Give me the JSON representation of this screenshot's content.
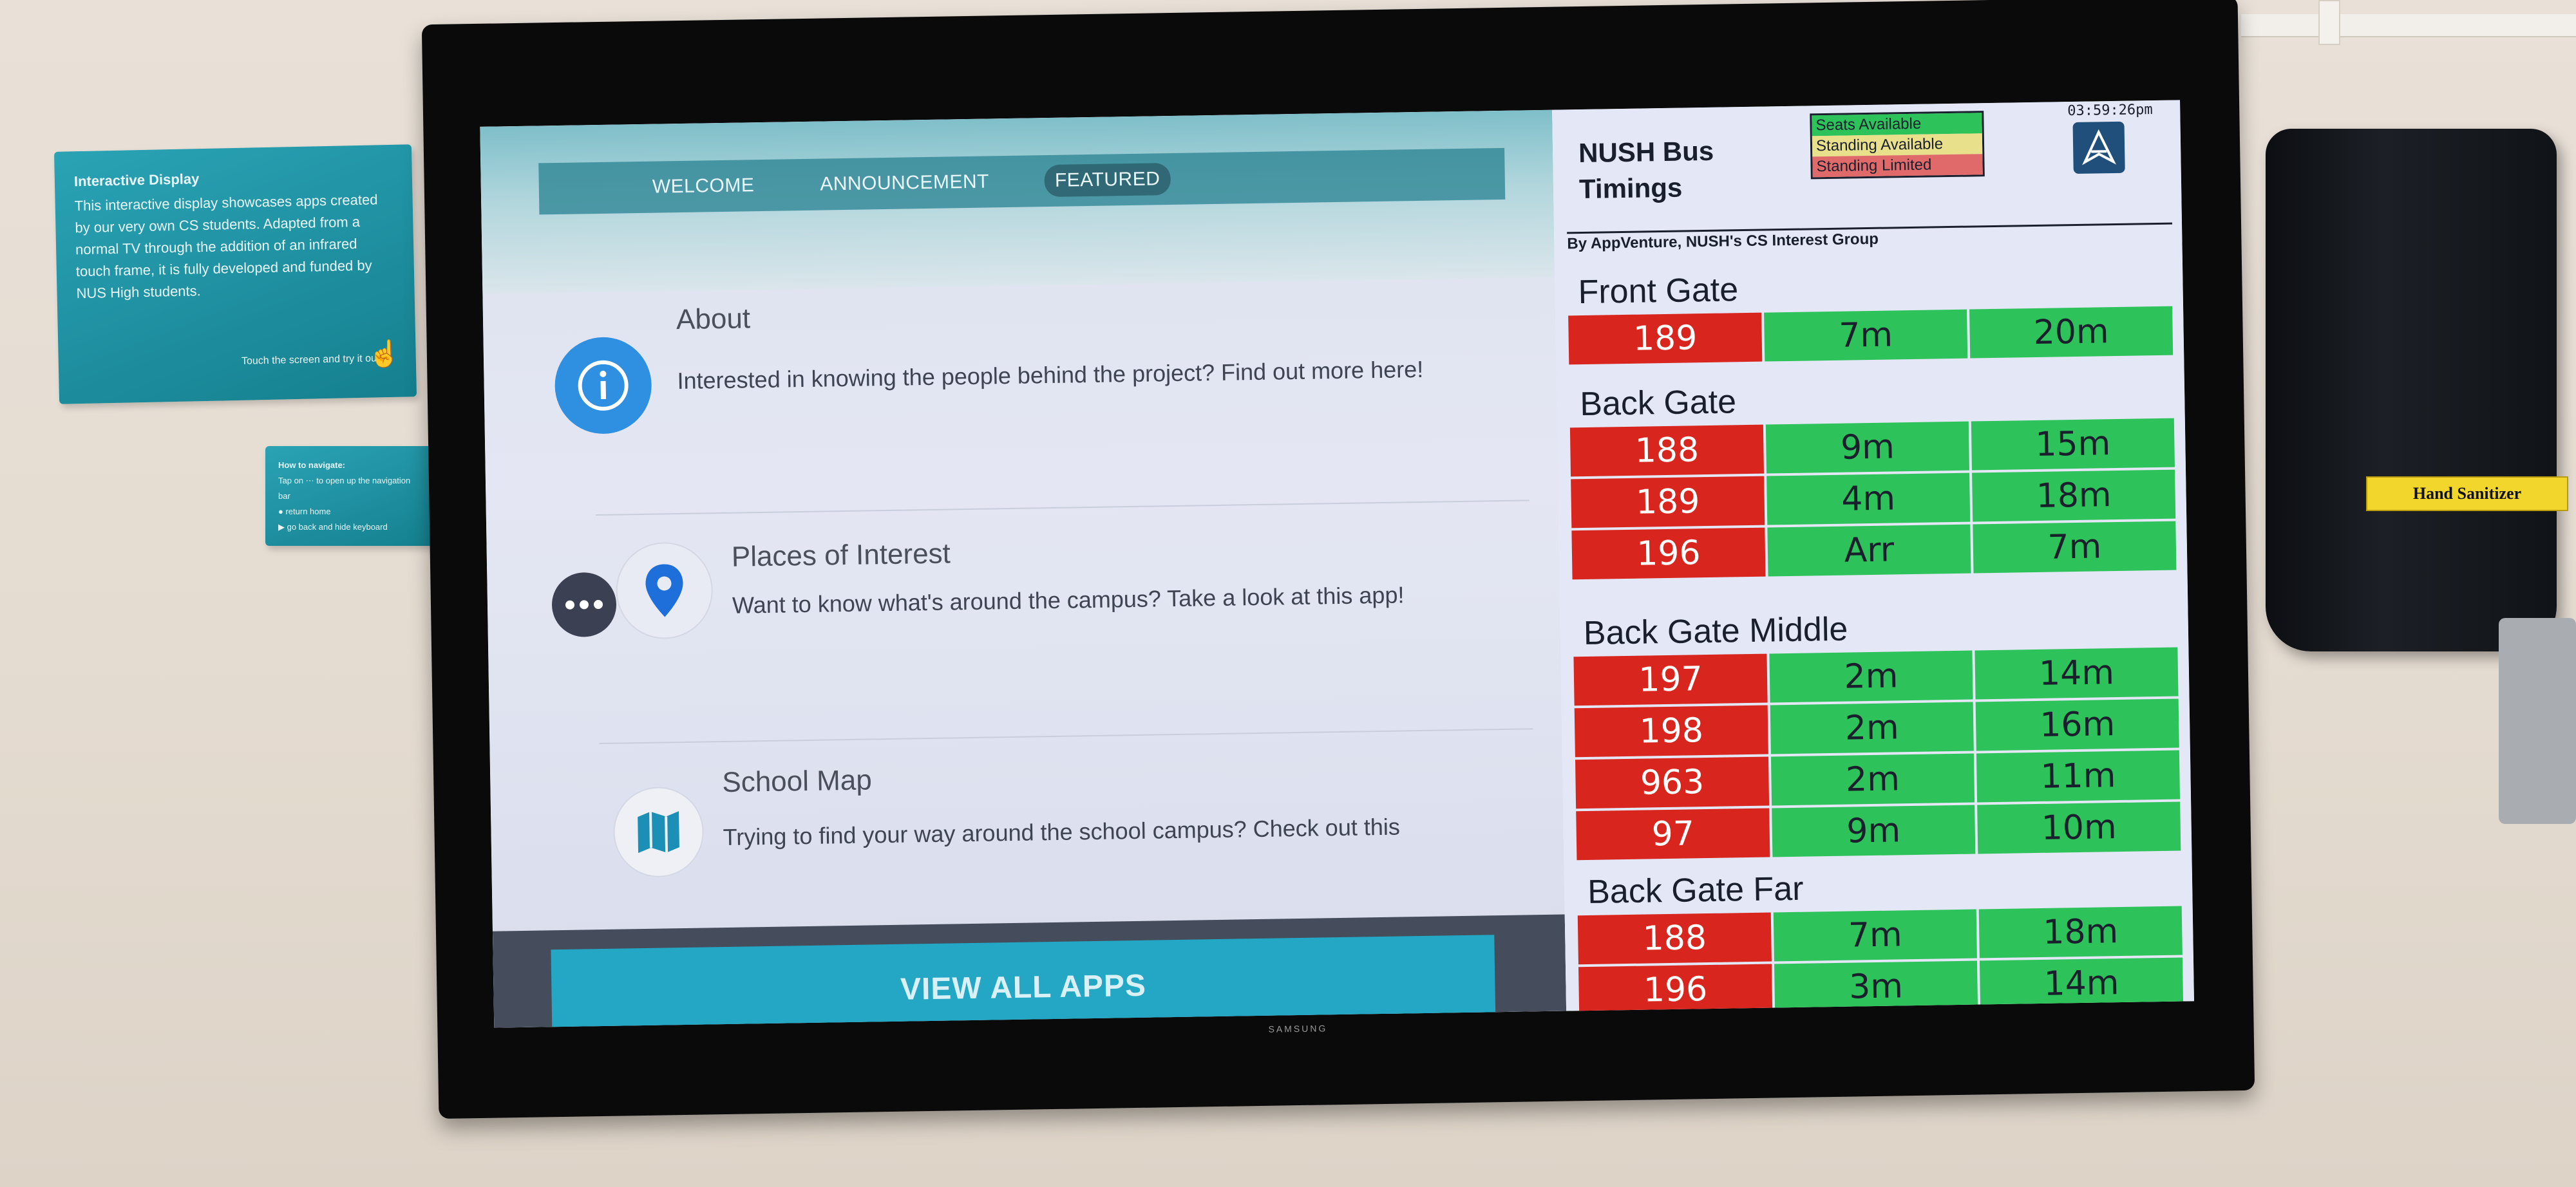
{
  "plaques": {
    "info": {
      "title": "Interactive Display",
      "text": "This interactive display showcases apps created by our very own CS students. Adapted from a normal TV through the addition of an infrared touch frame, it is fully developed and funded by NUS High students.",
      "touch_hint": "Touch the screen and try it out!"
    },
    "nav": {
      "title": "How to navigate:",
      "lines": [
        "Tap on ⋯ to open up the navigation bar",
        "● return home",
        "▶ go back and hide keyboard"
      ]
    }
  },
  "dispenser": {
    "label": "Hand Sanitizer"
  },
  "monitor": {
    "brand": "SAMSUNG"
  },
  "app": {
    "nav_tabs": [
      "WELCOME",
      "ANNOUNCEMENT",
      "FEATURED"
    ],
    "active_tab": "FEATURED",
    "features": [
      {
        "icon": "info-icon",
        "title": "About",
        "desc": "Interested in knowing the people behind the project? Find out more here!"
      },
      {
        "icon": "map-pin-icon",
        "title": "Places of Interest",
        "desc": "Want to know what's around the campus? Take a look at this app!"
      },
      {
        "icon": "folded-map-icon",
        "title": "School Map",
        "desc": "Trying to find your way around the school campus? Check out this"
      }
    ],
    "view_all_label": "VIEW ALL APPS"
  },
  "bus": {
    "title_line1": "NUSH Bus",
    "title_line2": "Timings",
    "clock": "03:59:26pm",
    "byline": "By AppVenture, NUSH's CS Interest Group",
    "legend": [
      {
        "label": "Seats Available",
        "color": "#2ec25b"
      },
      {
        "label": "Standing Available",
        "color": "#e8e08a"
      },
      {
        "label": "Standing Limited",
        "color": "#e06a6a"
      }
    ],
    "colors": {
      "service": "#d8261f",
      "seats": "#2ec25b"
    },
    "stops": [
      {
        "name": "Front Gate",
        "rows": [
          {
            "service": "189",
            "t1": "7m",
            "t2": "20m"
          }
        ]
      },
      {
        "name": "Back Gate",
        "rows": [
          {
            "service": "188",
            "t1": "9m",
            "t2": "15m"
          },
          {
            "service": "189",
            "t1": "4m",
            "t2": "18m"
          },
          {
            "service": "196",
            "t1": "Arr",
            "t2": "7m"
          }
        ]
      },
      {
        "name": "Back Gate Middle",
        "rows": [
          {
            "service": "197",
            "t1": "2m",
            "t2": "14m"
          },
          {
            "service": "198",
            "t1": "2m",
            "t2": "16m"
          },
          {
            "service": "963",
            "t1": "2m",
            "t2": "11m"
          },
          {
            "service": "97",
            "t1": "9m",
            "t2": "10m"
          }
        ]
      },
      {
        "name": "Back Gate Far",
        "rows": [
          {
            "service": "188",
            "t1": "7m",
            "t2": "18m"
          },
          {
            "service": "196",
            "t1": "3m",
            "t2": "14m"
          }
        ]
      }
    ]
  }
}
